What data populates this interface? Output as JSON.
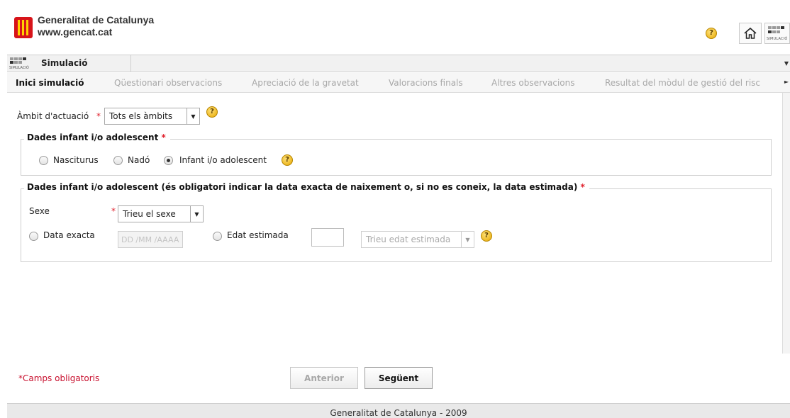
{
  "header": {
    "org_name": "Generalitat de Catalunya",
    "org_url": "www.gencat.cat",
    "help_icon": "help-icon",
    "home_icon": "home-icon",
    "module_icon_text": "SIMULACIÓ"
  },
  "titlebar": {
    "icon_text": "SIMULACIÓ",
    "title": "Simulació"
  },
  "tabs": [
    {
      "label": "Inici simulació",
      "active": true
    },
    {
      "label": "Qüestionari observacions",
      "active": false
    },
    {
      "label": "Apreciació de la gravetat",
      "active": false
    },
    {
      "label": "Valoracions finals",
      "active": false
    },
    {
      "label": "Altres observacions",
      "active": false
    },
    {
      "label": "Resultat del mòdul de gestió del risc",
      "active": false
    }
  ],
  "form": {
    "ambit": {
      "label": "Àmbit d'actuació",
      "required_mark": "*",
      "selected": "Tots els àmbits"
    },
    "section1": {
      "legend": "Dades infant i/o adolescent",
      "required_mark": "*",
      "options": [
        {
          "label": "Nasciturus",
          "checked": false
        },
        {
          "label": "Nadó",
          "checked": false
        },
        {
          "label": "Infant i/o adolescent",
          "checked": true
        }
      ]
    },
    "section2": {
      "legend": "Dades infant i/o adolescent (és obligatori indicar la data exacta de naixement o, si no es coneix, la data estimada)",
      "required_mark": "*",
      "sexe_label": "Sexe",
      "sexe_required": "*",
      "sexe_selected": "Trieu el sexe",
      "data_exacta_label": "Data exacta",
      "date_placeholder": "DD /MM /AAAA",
      "edat_estimada_label": "Edat estimada",
      "edat_select": "Trieu edat estimada"
    }
  },
  "footer_note": "*Camps obligatoris",
  "buttons": {
    "previous": "Anterior",
    "next": "Següent"
  },
  "footer": {
    "text": "Generalitat de Catalunya - 2009"
  },
  "colors": {
    "required": "#e0202c",
    "help": "#e6a700",
    "brand_red": "#d7141a"
  }
}
